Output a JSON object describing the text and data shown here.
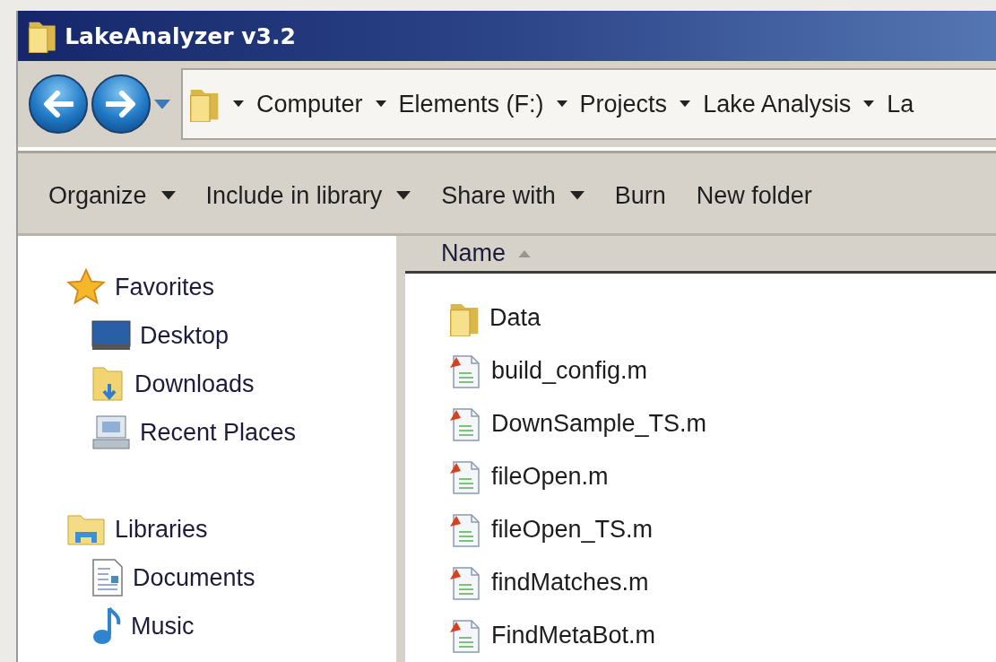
{
  "window": {
    "title": "LakeAnalyzer v3.2"
  },
  "address_bar": {
    "segments": [
      "Computer",
      "Elements (F:)",
      "Projects",
      "Lake Analysis",
      "La"
    ]
  },
  "toolbar": [
    {
      "label": "Organize",
      "has_menu": true
    },
    {
      "label": "Include in library",
      "has_menu": true
    },
    {
      "label": "Share with",
      "has_menu": true
    },
    {
      "label": "Burn",
      "has_menu": false
    },
    {
      "label": "New folder",
      "has_menu": false
    }
  ],
  "sidebar": {
    "groups": [
      {
        "label": "Favorites",
        "kind": "favorites",
        "children": [
          {
            "label": "Desktop",
            "kind": "desktop"
          },
          {
            "label": "Downloads",
            "kind": "downloads"
          },
          {
            "label": "Recent Places",
            "kind": "recent"
          }
        ]
      },
      {
        "label": "Libraries",
        "kind": "libraries",
        "children": [
          {
            "label": "Documents",
            "kind": "documents"
          },
          {
            "label": "Music",
            "kind": "music"
          }
        ]
      }
    ]
  },
  "file_list": {
    "columns": [
      {
        "label": "Name",
        "sorted_ascending": true
      }
    ],
    "rows": [
      {
        "name": "Data",
        "kind": "folder"
      },
      {
        "name": "build_config.m",
        "kind": "matlab"
      },
      {
        "name": "DownSample_TS.m",
        "kind": "matlab"
      },
      {
        "name": "fileOpen.m",
        "kind": "matlab"
      },
      {
        "name": "fileOpen_TS.m",
        "kind": "matlab"
      },
      {
        "name": "findMatches.m",
        "kind": "matlab"
      },
      {
        "name": "FindMetaBot.m",
        "kind": "matlab"
      }
    ]
  }
}
